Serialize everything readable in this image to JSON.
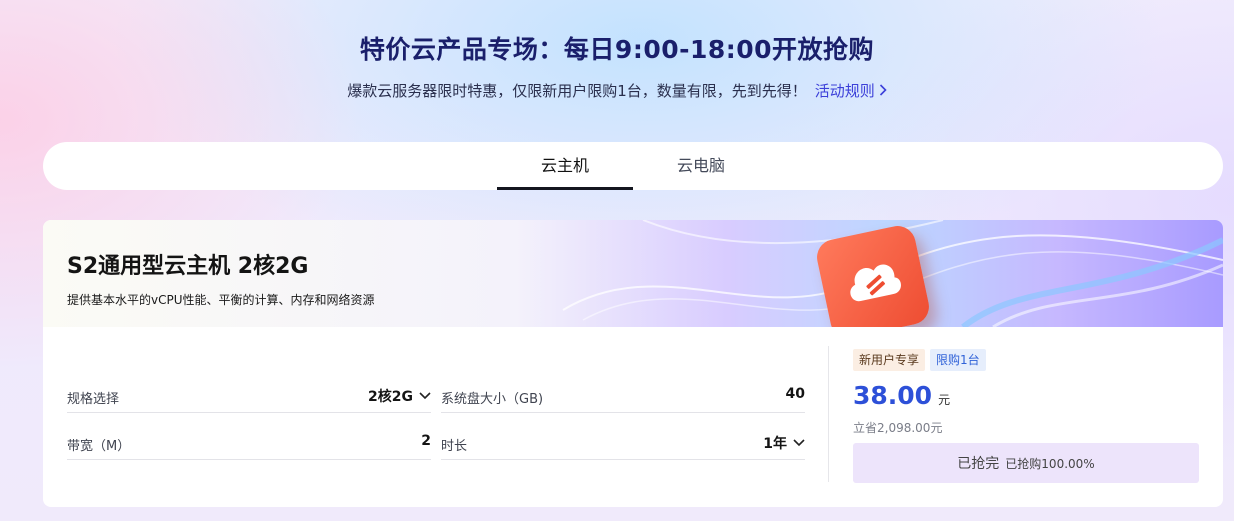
{
  "hero": {
    "title": "特价云产品专场：每日9:00-18:00开放抢购",
    "subtitle": "爆款云服务器限时特惠，仅限新用户限购1台，数量有限，先到先得！",
    "rules_link": "活动规则"
  },
  "tabs": [
    {
      "label": "云主机",
      "active": true
    },
    {
      "label": "云电脑",
      "active": false
    }
  ],
  "product": {
    "name": "S2通用型云主机 2核2G",
    "description": "提供基本水平的vCPU性能、平衡的计算、内存和网络资源",
    "specs": {
      "spec_label": "规格选择",
      "spec_value": "2核2G",
      "disk_label": "系统盘大小（GB)",
      "disk_value": "40",
      "bandwidth_label": "带宽（M）",
      "bandwidth_value": "2",
      "duration_label": "时长",
      "duration_value": "1年"
    },
    "tags": {
      "new_user": "新用户专享",
      "limit": "限购1台"
    },
    "price": {
      "amount": "38.00",
      "unit": "元",
      "saving": "立省2,098.00元"
    },
    "button": {
      "label": "已抢完",
      "sold_pct": "已抢购100.00%"
    }
  },
  "colors": {
    "title": "#1a1f6b",
    "link": "#3b3fd9",
    "price": "#2d50d8",
    "button_bg": "#ede4fb",
    "logo": "#ee4d32"
  },
  "icons": {
    "rules_link": "chevron-right-icon",
    "spec_select": "chevron-down-icon",
    "duration_select": "chevron-down-icon",
    "product_logo": "cloud-server-logo"
  }
}
